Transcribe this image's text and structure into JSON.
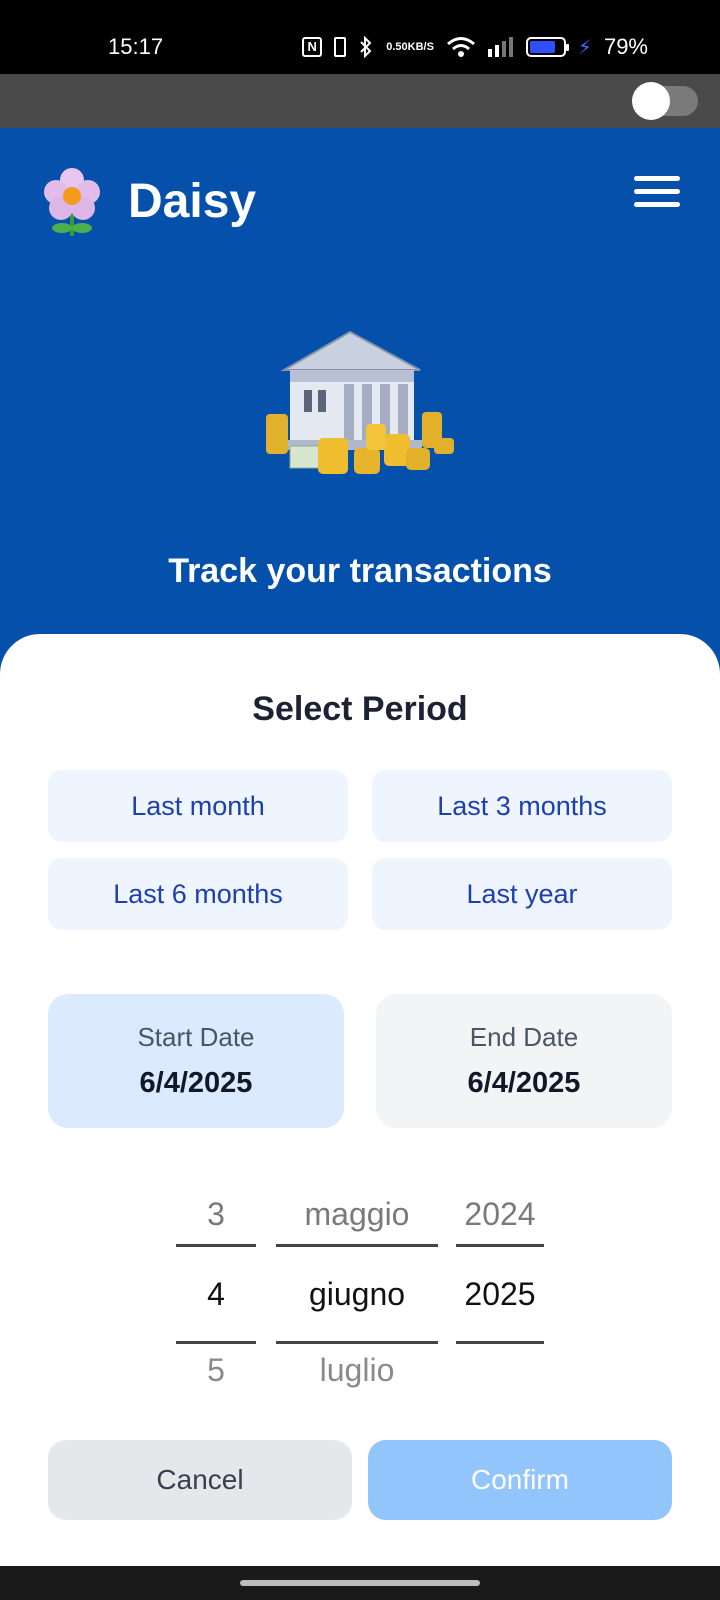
{
  "status_bar": {
    "time": "15:17",
    "net_speed_value": "0.50",
    "net_speed_unit": "KB/S",
    "battery": "79%",
    "nfc_label": "N"
  },
  "header": {
    "app_name": "Daisy",
    "tagline": "Track your transactions"
  },
  "sheet": {
    "title": "Select Period",
    "presets": [
      "Last month",
      "Last 3 months",
      "Last 6 months",
      "Last year"
    ],
    "start_date": {
      "label": "Start Date",
      "value": "6/4/2025"
    },
    "end_date": {
      "label": "End Date",
      "value": "6/4/2025"
    },
    "picker": {
      "day": {
        "prev": "3",
        "current": "4",
        "next": "5"
      },
      "month": {
        "prev": "maggio",
        "current": "giugno",
        "next": "luglio"
      },
      "year": {
        "prev": "2024",
        "current": "2025",
        "next": ""
      }
    },
    "cancel_label": "Cancel",
    "confirm_label": "Confirm"
  },
  "colors": {
    "brand_blue": "#0550ab",
    "preset_bg": "#eef5ff",
    "preset_text": "#1e40af",
    "confirm_bg": "#93c5fd",
    "start_bg": "#dbeafe"
  },
  "icons": [
    "nfc-icon",
    "vibrate-icon",
    "bluetooth-icon",
    "wifi-icon",
    "signal-icon",
    "battery-icon",
    "flower-logo-icon",
    "menu-icon",
    "bank-coins-illustration"
  ]
}
